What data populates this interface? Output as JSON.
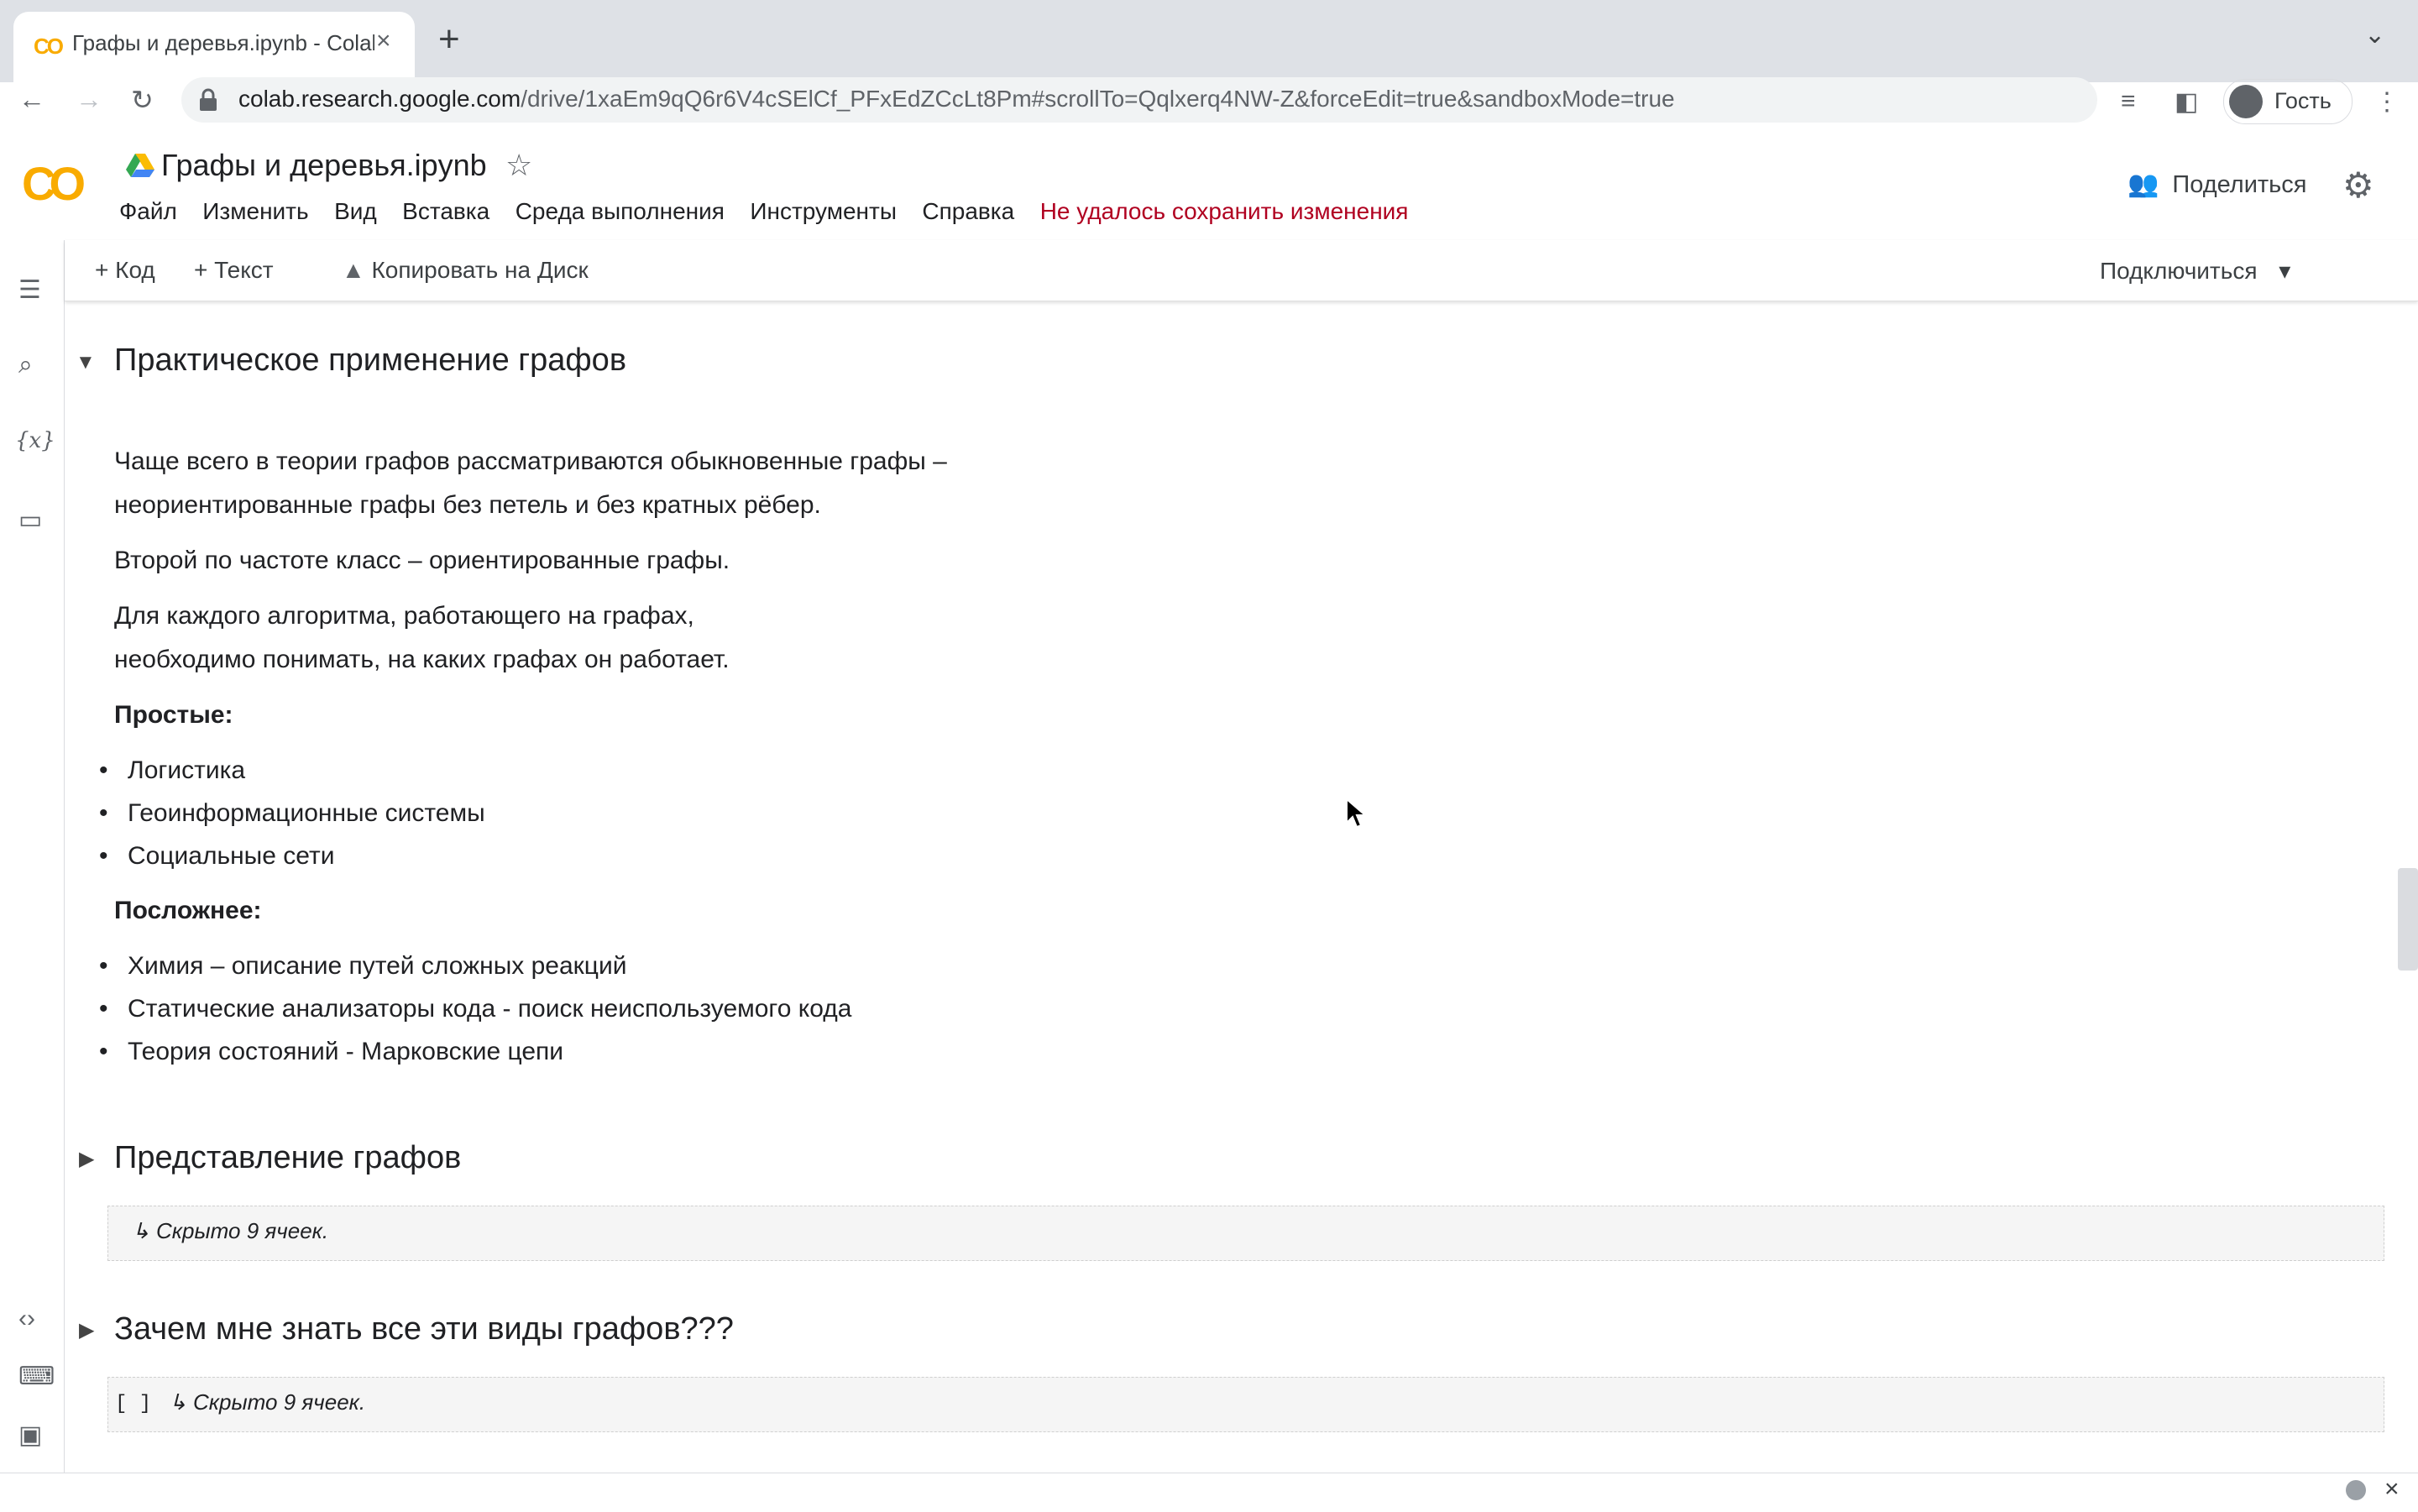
{
  "browser": {
    "tab_title": "Графы и деревья.ipynb - Colab",
    "new_tab": "+",
    "url_host": "colab.research.google.com",
    "url_path": "/drive/1xaEm9qQ6r6V4cSElCf_PFxEdZCcLt8Pm#scrollTo=Qqlxerq4NW-Z&forceEdit=true&sandboxMode=true",
    "profile_label": "Гость"
  },
  "colab": {
    "notebook_title": "Графы и деревья.ipynb",
    "menu": [
      "Файл",
      "Изменить",
      "Вид",
      "Вставка",
      "Среда выполнения",
      "Инструменты",
      "Справка"
    ],
    "save_warning": "Не удалось сохранить изменения",
    "share_label": "Поделиться",
    "toolbar": {
      "code_label": "Код",
      "text_label": "Текст",
      "copy_to_drive": "Копировать на Диск",
      "connect_label": "Подключиться"
    }
  },
  "content": {
    "section1_title": "Практическое применение графов",
    "p1_line1": "Чаще всего в теории графов рассматриваются обыкновенные графы –",
    "p1_line2": "неориентированные графы без петель и без кратных рёбер.",
    "p2": "Второй по частоте класс – ориентированные графы.",
    "p3_line1": "Для каждого алгоритма, работающего на графах,",
    "p3_line2": "необходимо понимать, на каких графах он работает.",
    "simple_heading": "Простые:",
    "simple_items": [
      "Логистика",
      "Геоинформационные системы",
      "Социальные сети"
    ],
    "complex_heading": "Посложнее:",
    "complex_items": [
      "Химия – описание путей сложных реакций",
      "Статические анализаторы кода - поиск неиспользуемого кода",
      "Теория состояний - Марковские цепи"
    ],
    "section2_title": "Представление графов",
    "section2_hidden": "↳ Скрыто 9 ячеек.",
    "section3_title": "Зачем мне знать все эти виды графов???",
    "section3_exec": "[ ]",
    "section3_hidden": "↳ Скрыто 9 ячеек."
  }
}
